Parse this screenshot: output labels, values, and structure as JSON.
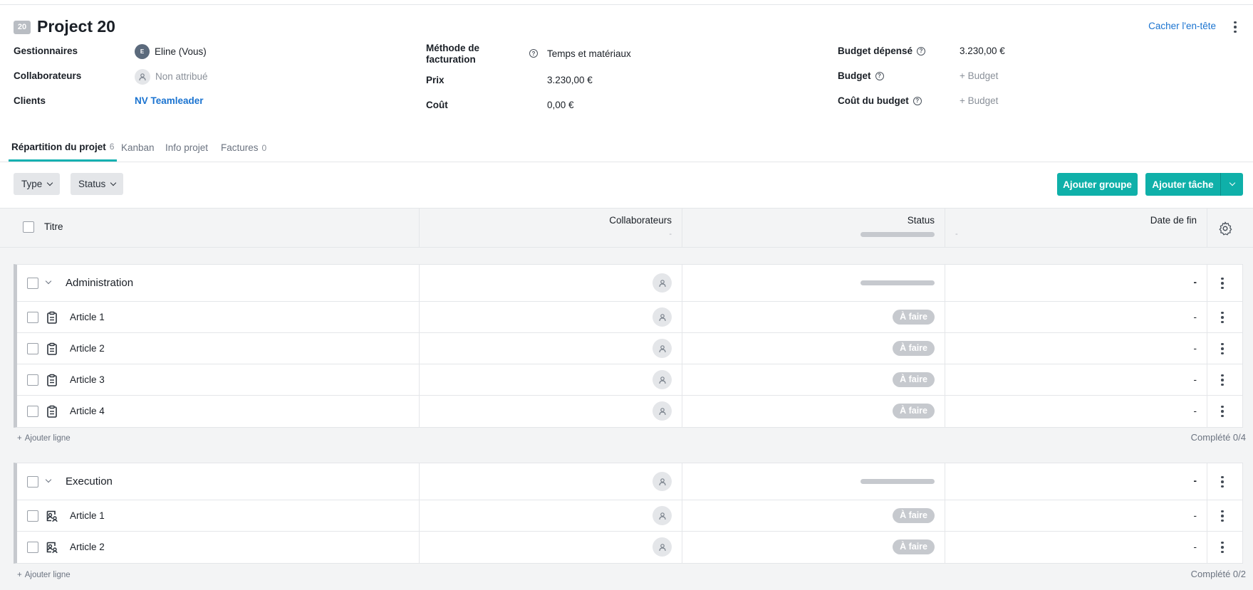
{
  "project": {
    "id_badge": "20",
    "title": "Project 20",
    "hide_header_label": "Cacher l'en-tête"
  },
  "fields": {
    "managers_label": "Gestionnaires",
    "managers_value": "Eline (Vous)",
    "managers_avatar_initial": "E",
    "collaborators_label": "Collaborateurs",
    "collaborators_value": "Non attribué",
    "clients_label": "Clients",
    "clients_value": "NV Teamleader",
    "billing_method_label": "Méthode de facturation",
    "billing_method_value": "Temps et matériaux",
    "price_label": "Prix",
    "price_value": "3.230,00 €",
    "cost_label": "Coût",
    "cost_value": "0,00 €",
    "budget_spent_label": "Budget dépensé",
    "budget_spent_value": "3.230,00 €",
    "budget_label": "Budget",
    "budget_value": "+ Budget",
    "budget_cost_label": "Coût du budget",
    "budget_cost_value": "+ Budget"
  },
  "tabs": [
    {
      "label": "Répartition du projet",
      "count": "6",
      "active": true
    },
    {
      "label": "Kanban",
      "count": ""
    },
    {
      "label": "Info projet",
      "count": ""
    },
    {
      "label": "Factures",
      "count": "0"
    }
  ],
  "toolbar": {
    "filter_type": "Type",
    "filter_status": "Status",
    "add_group": "Ajouter groupe",
    "add_task": "Ajouter tâche"
  },
  "table": {
    "col_title": "Titre",
    "col_collaborators": "Collaborateurs",
    "col_collaborators_sub": "-",
    "col_status": "Status",
    "col_end_date": "Date de fin",
    "col_end_date_sub": "-"
  },
  "groups": [
    {
      "title": "Administration",
      "end_date": "-",
      "add_line": "Ajouter ligne",
      "completed": "Complété 0/4",
      "icon": "clipboard-icon",
      "items": [
        {
          "title": "Article 1",
          "status": "À faire",
          "end_date": "-"
        },
        {
          "title": "Article 2",
          "status": "À faire",
          "end_date": "-"
        },
        {
          "title": "Article 3",
          "status": "À faire",
          "end_date": "-"
        },
        {
          "title": "Article 4",
          "status": "À faire",
          "end_date": "-"
        }
      ]
    },
    {
      "title": "Execution",
      "end_date": "-",
      "add_line": "Ajouter ligne",
      "completed": "Complété 0/2",
      "icon": "person-card-icon",
      "items": [
        {
          "title": "Article 1",
          "status": "À faire",
          "end_date": "-"
        },
        {
          "title": "Article 2",
          "status": "À faire",
          "end_date": "-"
        }
      ]
    }
  ],
  "colors": {
    "accent": "#0fb0a9",
    "link": "#1a73d0",
    "status_todo": "#c6c9ce"
  }
}
